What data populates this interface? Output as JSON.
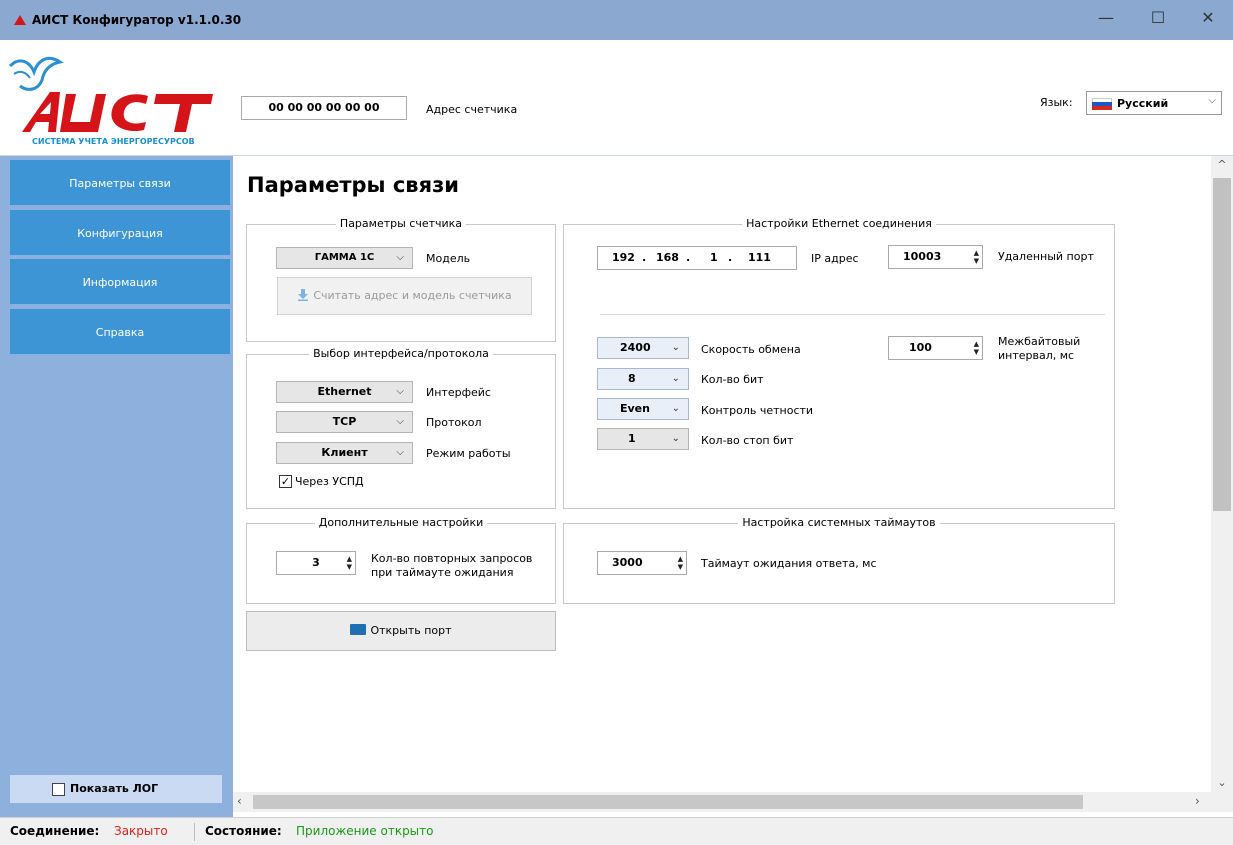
{
  "window": {
    "title": "АИСТ Конфигуратор v1.1.0.30",
    "minimize": "—",
    "maximize": "☐",
    "close": "✕"
  },
  "header": {
    "logo_subtitle": "СИСТЕМА УЧЕТА ЭНЕРГОРЕСУРСОВ",
    "address_value": "00 00 00 00 00 00",
    "address_label": "Адрес счетчика",
    "language_label": "Язык:",
    "language_value": "Русский"
  },
  "sidebar": {
    "items": [
      {
        "label": "Параметры связи"
      },
      {
        "label": "Конфигурация"
      },
      {
        "label": "Информация"
      },
      {
        "label": "Справка"
      }
    ],
    "show_log_label": "Показать ЛОГ"
  },
  "main": {
    "title": "Параметры связи",
    "meter_params": {
      "title": "Параметры счетчика",
      "model_value": "ГАММА 1С",
      "model_label": "Модель",
      "read_button": "Считать адрес и модель счетчика"
    },
    "interface": {
      "title": "Выбор интерфейса/протокола",
      "interface_value": "Ethernet",
      "interface_label": "Интерфейс",
      "protocol_value": "TCP",
      "protocol_label": "Протокол",
      "mode_value": "Клиент",
      "mode_label": "Режим работы",
      "via_uspd_label": "Через УСПД"
    },
    "extra": {
      "title": "Дополнительные настройки",
      "retries_value": "3",
      "retries_label_1": "Кол-во повторных запросов",
      "retries_label_2": "при таймауте ожидания"
    },
    "open_port_button": "Открыть порт",
    "ethernet": {
      "title": "Настройки Ethernet соединения",
      "ip": [
        "192",
        "168",
        "1",
        "111"
      ],
      "ip_label": "IP адрес",
      "port_value": "10003",
      "port_label": "Удаленный порт",
      "baud_value": "2400",
      "baud_label": "Скорость обмена",
      "bits_value": "8",
      "bits_label": "Кол-во бит",
      "parity_value": "Even",
      "parity_label": "Контроль четности",
      "stopbits_value": "1",
      "stopbits_label": "Кол-во стоп бит",
      "interbyte_value": "100",
      "interbyte_label_1": "Межбайтовый",
      "interbyte_label_2": "интервал, мс"
    },
    "timeouts": {
      "title": "Настройка системных таймаутов",
      "response_value": "3000",
      "response_label": "Таймаут ожидания ответа, мс"
    }
  },
  "status": {
    "connection_label": "Соединение:",
    "connection_value": "Закрыто",
    "connection_color": "#e0201b",
    "state_label": "Состояние:",
    "state_value": "Приложение открыто",
    "state_color": "#1a9a1a"
  }
}
